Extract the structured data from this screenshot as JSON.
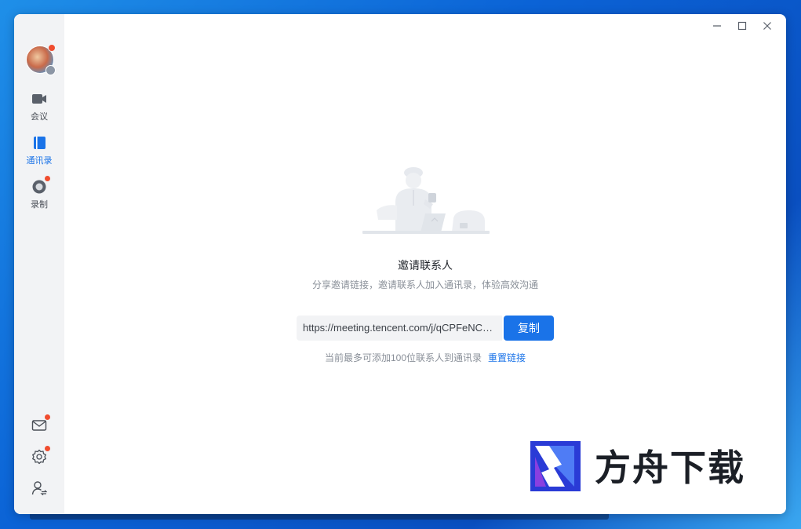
{
  "window": {
    "controls": {
      "minimize": "minimize-icon",
      "maximize": "maximize-icon",
      "close": "close-icon"
    }
  },
  "sidebar": {
    "avatar": "avatar",
    "items": [
      {
        "label": "会议",
        "icon": "video-camera-icon",
        "active": false,
        "badge": false
      },
      {
        "label": "通讯录",
        "icon": "contacts-book-icon",
        "active": true,
        "badge": false
      },
      {
        "label": "录制",
        "icon": "record-icon",
        "active": false,
        "badge": true
      }
    ],
    "bottom": [
      {
        "icon": "mail-icon",
        "badge": true
      },
      {
        "icon": "settings-gear-icon",
        "badge": true
      },
      {
        "icon": "user-switch-icon",
        "badge": false
      }
    ]
  },
  "main": {
    "title": "邀请联系人",
    "subtitle": "分享邀请链接，邀请联系人加入通讯录，体验高效沟通",
    "invite_link": "https://meeting.tencent.com/j/qCPFeNCL...",
    "copy_label": "复制",
    "hint": "当前最多可添加100位联系人到通讯录",
    "reset_label": "重置链接"
  },
  "watermark": {
    "text": "方舟下载"
  },
  "colors": {
    "accent": "#1a73e8",
    "badge": "#f04c2e",
    "sidebar_bg": "#f2f3f5"
  }
}
